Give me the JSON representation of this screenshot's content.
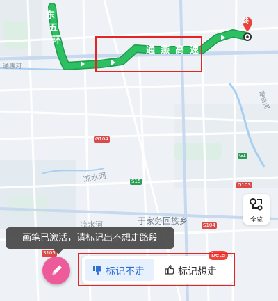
{
  "route": {
    "highway_chars": [
      "通",
      "燕",
      "高",
      "速"
    ],
    "ring_chars": [
      "东",
      "五",
      "环"
    ],
    "end_marker": "终",
    "route_color": "#2dc063",
    "route_outline": "#1f9b4c"
  },
  "places": {
    "tonghui_river": "通惠河",
    "liangshui_river": "凉水河",
    "chaobai_river": "潮白河",
    "township": "于家务回族乡",
    "partial_label": "凉水河"
  },
  "road_badges": {
    "s15": "S15",
    "g1": "G1",
    "g103": "G103",
    "g104": "G104",
    "s104": "S104",
    "s105": "S105"
  },
  "controls": {
    "overview_label": "全览"
  },
  "tooltip": {
    "text": "画笔已激活，请标记出不想走路段"
  },
  "mark_panel": {
    "avoid_label": "标记不走",
    "prefer_label": "标记想走",
    "beta_label": "beta"
  },
  "colors": {
    "pen_button": "#ee5b9a",
    "avoid_button_text": "#2f6fd6",
    "highlight_box": "#e52424"
  }
}
